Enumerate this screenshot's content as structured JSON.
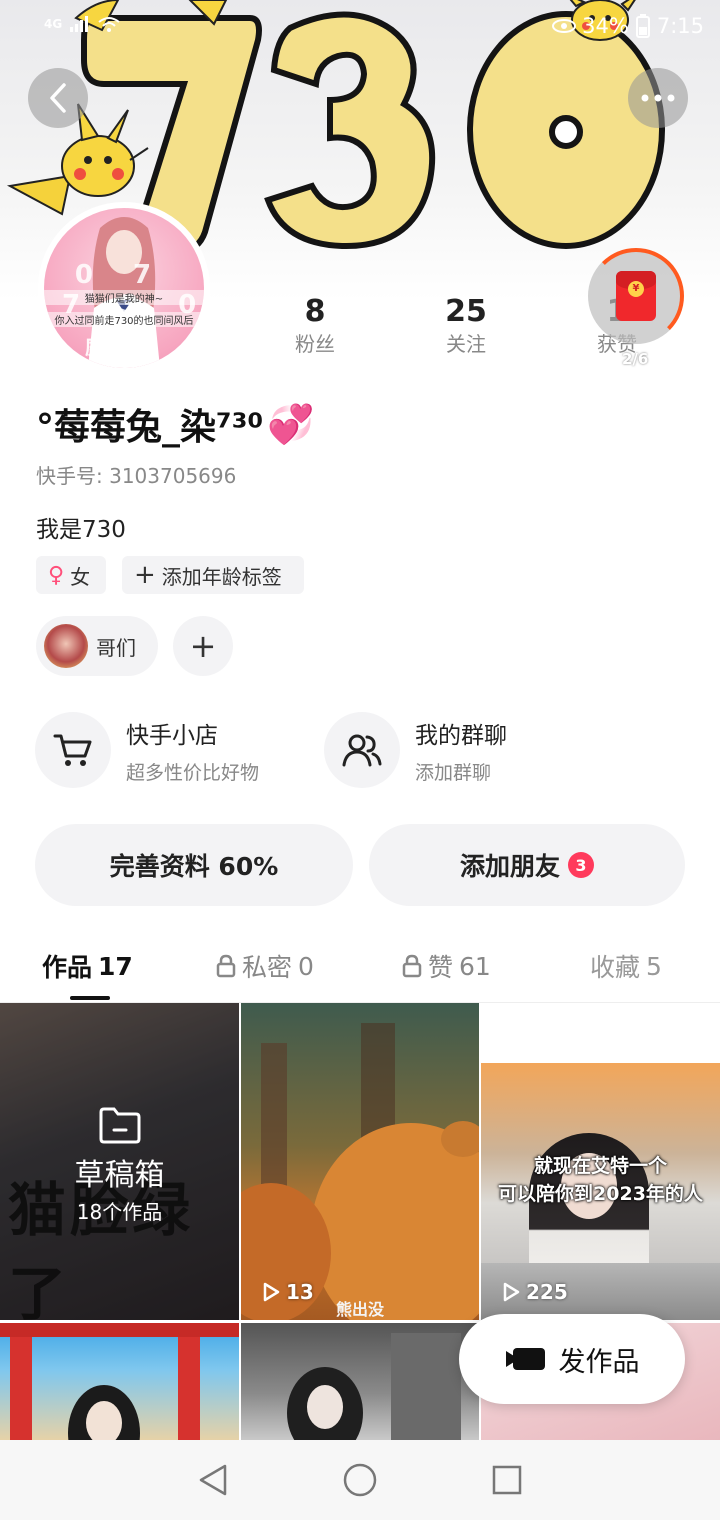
{
  "status_bar": {
    "network": "4G",
    "battery": "34%",
    "time": "7:15"
  },
  "banner": {
    "number_art": "730"
  },
  "avatar": {
    "numbers": "07 730",
    "caption_1": "猫猫们是我的神~",
    "caption_2": "你入过同前走730的也同间风后",
    "signature": "庭丽婷"
  },
  "stats": [
    {
      "value": "8",
      "label": "粉丝"
    },
    {
      "value": "25",
      "label": "关注"
    },
    {
      "value": "1",
      "label": "获赞"
    }
  ],
  "red_packet": {
    "counter": "2/6"
  },
  "profile": {
    "username": "°莓莓兔_染⁷³⁰",
    "id_line": "快手号: 3103705696",
    "bio": "我是730",
    "gender": "女",
    "age_tag": "添加年龄标签",
    "group_chip": "哥们"
  },
  "services": {
    "shop": {
      "title": "快手小店",
      "subtitle": "超多性价比好物"
    },
    "group_chat": {
      "title": "我的群聊",
      "subtitle": "添加群聊"
    }
  },
  "actions": {
    "complete_profile": "完善资料 60%",
    "add_friend": "添加朋友",
    "add_friend_badge": "3"
  },
  "tabs": [
    {
      "label": "作品",
      "count": "17"
    },
    {
      "label": "私密",
      "count": "0"
    },
    {
      "label": "赞",
      "count": "61"
    },
    {
      "label": "收藏",
      "count": "5"
    }
  ],
  "grid": {
    "draft": {
      "background_text": "猫脸绿了",
      "label": "草稿箱",
      "count": "18个作品"
    },
    "item2": {
      "plays": "13",
      "watermark": "熊出没"
    },
    "item3": {
      "plays": "225",
      "caption_1": "就现在艾特一个",
      "caption_2": "可以陪你到2023年的人"
    }
  },
  "fab": {
    "label": "发作品"
  },
  "colors": {
    "accent": "#ff3a5c",
    "chip_bg": "#f3f3f5",
    "banner_yellow": "#f4e08a"
  }
}
